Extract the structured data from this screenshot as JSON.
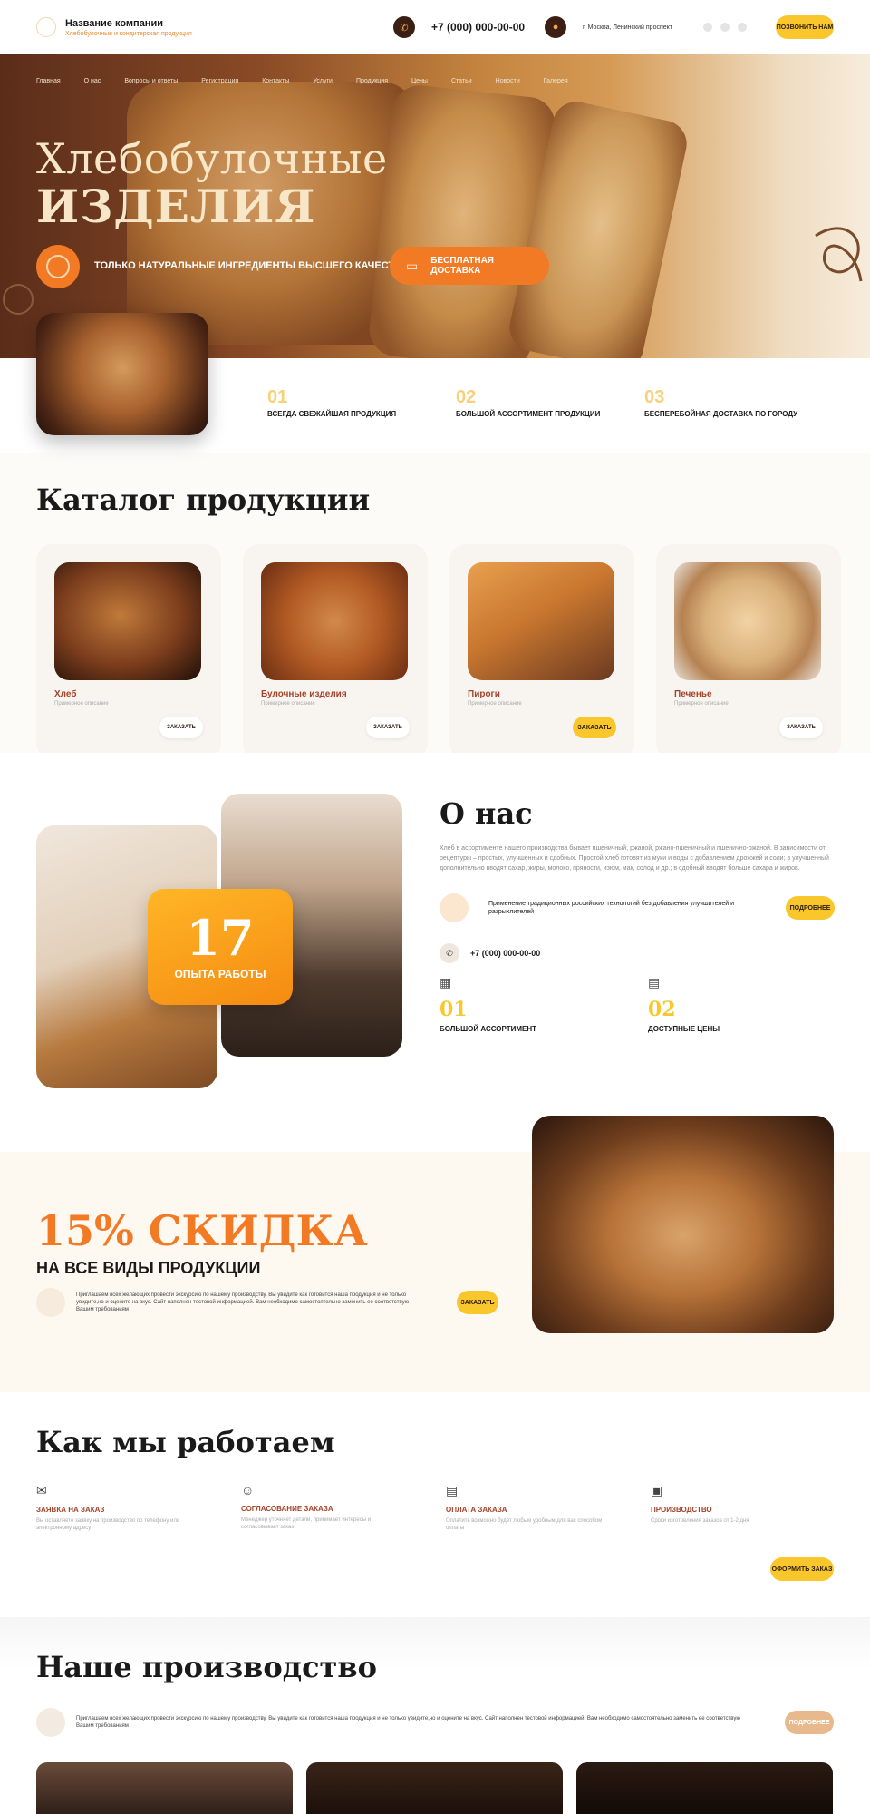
{
  "header": {
    "company_name": "Название компании",
    "company_sub": "Хлебобулочные и кондитерская продукция",
    "phone": "+7 (000) 000-00-00",
    "address": "г. Москва, Ленинский проспект",
    "callback_label": "Позвонить нам"
  },
  "nav": [
    "Главная",
    "О нас",
    "Вопросы и ответы",
    "Регистрация",
    "Контакты",
    "Услуги",
    "Продукция",
    "Цены",
    "Статьи",
    "Новости",
    "Галерея"
  ],
  "hero": {
    "title_line1": "Хлебобулочные",
    "title_line2": "ИЗДЕЛИЯ",
    "ingredients": "Только натуральные ингредиенты высшего качества",
    "delivery": "Бесплатная доставка"
  },
  "features": [
    {
      "num": "01",
      "text": "Всегда свежайшая продукция"
    },
    {
      "num": "02",
      "text": "Большой ассортимент продукции"
    },
    {
      "num": "03",
      "text": "Бесперебойная доставка по городу"
    }
  ],
  "catalog": {
    "title": "Каталог продукции",
    "items": [
      {
        "name": "Хлеб",
        "desc": "Примерное описание",
        "order": "Заказать",
        "img": "#7a3c1c"
      },
      {
        "name": "Булочные изделия",
        "desc": "Примерное описание",
        "order": "Заказать",
        "img": "#b35a24"
      },
      {
        "name": "Пироги",
        "desc": "Примерное описание",
        "order": "Заказать",
        "img": "#c9772f"
      },
      {
        "name": "Печенье",
        "desc": "Примерное описание",
        "order": "Заказать",
        "img": "#d9b07a"
      }
    ]
  },
  "about": {
    "title": "О нас",
    "text": "Хлеб в ассортименте нашего производства бывает пшеничный, ржаной, ржано-пшеничный и пшенично-ржаной. В зависимости от рецептуры – простых, улучшенных и сдобных. Простой хлеб готовят из муки и воды с добавлением дрожжей и соли; в улучшенный дополнительно вводят сахар, жиры, молоко, пряности, изюм, мак, солод и др.; в сдобный вводят больше сахара и жиров.",
    "tech": "Применение традиционных российских технологий без добавления улучшителей и разрыхлителей",
    "more": "Подробнее",
    "phone": "+7 (000) 000-00-00",
    "years": "17",
    "years_label": "Опыта работы",
    "stats": [
      {
        "num": "01",
        "label": "Большой ассортимент"
      },
      {
        "num": "02",
        "label": "Доступные цены"
      }
    ]
  },
  "discount": {
    "big": "15% СКИДКА",
    "sub": "На все виды продукции",
    "text": "Приглашаем всех желающих провести экскурсию по нашему производству. Вы увидите как готовится наша продукция и не только увидите,но и оцените на вкус. Сайт наполнен тестовой информацией. Вам необходимо самостоятельно заменить ее соответствую Вашим требованиям",
    "button": "Заказать"
  },
  "how": {
    "title": "Как мы работаем",
    "steps": [
      {
        "title": "Заявка на заказ",
        "desc": "Вы оставляете заявку на производство по телефону или электронному адресу"
      },
      {
        "title": "Согласование заказа",
        "desc": "Менеджер уточняет детали, принимает интересы и согласовывает заказ"
      },
      {
        "title": "Оплата заказа",
        "desc": "Оплатить возможно будет любым удобным для вас способом оплаты"
      },
      {
        "title": "Производство",
        "desc": "Сроки изготовления заказов от 1-2 дня"
      }
    ],
    "button": "Оформить заказ"
  },
  "production": {
    "title": "Наше производство",
    "text": "Приглашаем всех желающих провести экскурсию по нашему производству. Вы увидите как готовится наша продукция и не только увидите,но и оцените на вкус. Сайт наполнен тестовой информацией. Вам необходимо самостоятельно заменить ее соответствую Вашим требованиям",
    "button": "Подробнее"
  }
}
